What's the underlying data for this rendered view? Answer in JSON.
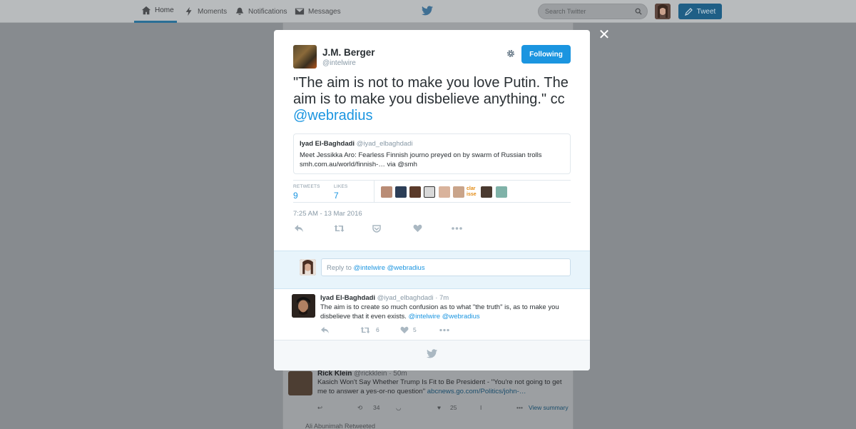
{
  "nav": {
    "home": "Home",
    "moments": "Moments",
    "notifications": "Notifications",
    "messages": "Messages",
    "search_placeholder": "Search Twitter",
    "tweet_button": "Tweet"
  },
  "modal": {
    "close": "✕",
    "author": {
      "name": "J.M. Berger",
      "handle": "@intelwire"
    },
    "follow_label": "Following",
    "text_main": "\"The aim is not to make you love Putin. The aim is to make you disbelieve anything.\" cc",
    "text_mention": "@webradius",
    "quote": {
      "name": "Iyad El-Baghdadi",
      "handle": "@iyad_elbaghdadi",
      "line1": "Meet Jessikka Aro: Fearless Finnish journo preyed on by swarm of Russian trolls",
      "line2": "smh.com.au/world/finnish-… via @smh"
    },
    "stats": {
      "retweets_label": "RETWEETS",
      "retweets": "9",
      "likes_label": "LIKES",
      "likes": "7",
      "liker_text": "clar isse"
    },
    "timestamp": "7:25 AM - 13 Mar 2016",
    "reply": {
      "prefix": "Reply to",
      "mention1": "@intelwire",
      "mention2": "@webradius"
    },
    "reply_tweet": {
      "name": "Iyad El-Baghdadi",
      "handle": "@iyad_elbaghdadi",
      "time": "· 7m",
      "text": "The aim is to create so much confusion as to what \"the truth\" is, as to make you disbelieve that it even exists.",
      "mention1": "@intelwire",
      "mention2": "@webradius",
      "retweets": "6",
      "likes": "5"
    }
  },
  "background": {
    "tweet": {
      "name": "Rick Klein",
      "handle": "@rickklein",
      "time": "· 50m",
      "text": "Kasich Won't Say Whether Trump Is Fit to Be President - \"You're not going to get me to answer a yes-or-no question\"",
      "link": "abcnews.go.com/Politics/john-…",
      "retweets": "34",
      "likes": "25",
      "view_summary": "View summary"
    },
    "next_retweeted": "Ali Abunimah Retweeted"
  },
  "colors": {
    "accent": "#1b95e0",
    "overlay_bg": "#878b8f",
    "reply_bg": "#e8f4fb"
  }
}
